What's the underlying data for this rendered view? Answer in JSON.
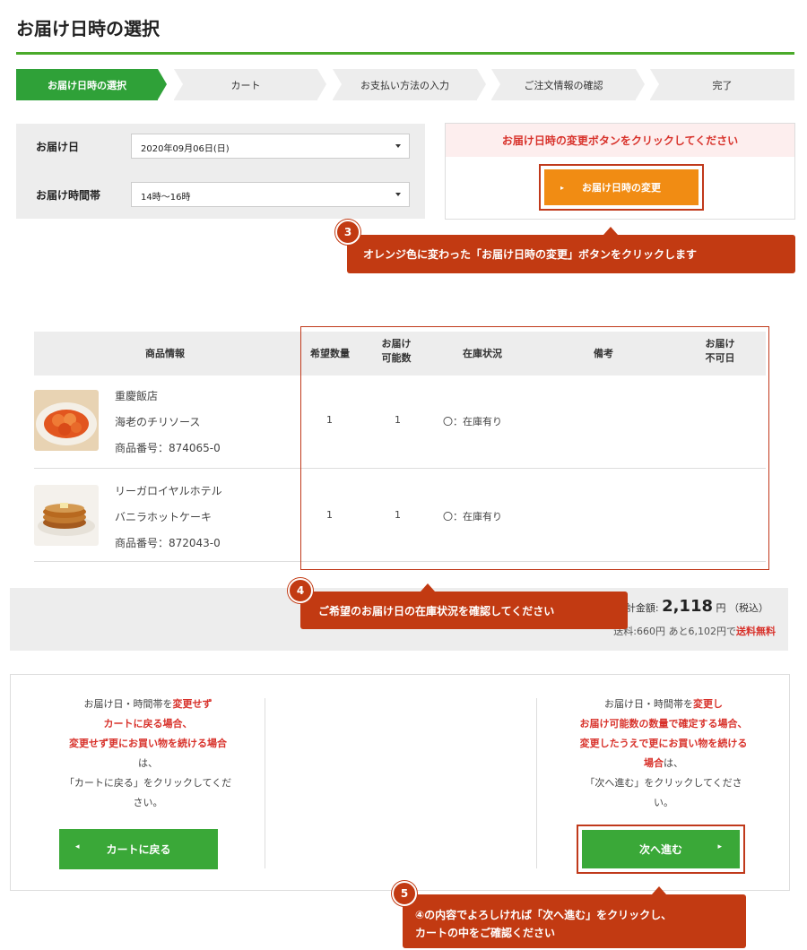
{
  "page_title": "お届け日時の選択",
  "steps": [
    {
      "label": "お届け日時の選択",
      "active": true
    },
    {
      "label": "カート",
      "active": false
    },
    {
      "label": "お支払い方法の入力",
      "active": false
    },
    {
      "label": "ご注文情報の確認",
      "active": false
    },
    {
      "label": "完了",
      "active": false
    }
  ],
  "form": {
    "date_label": "お届け日",
    "date_value": "2020年09月06日(日)",
    "time_label": "お届け時間帯",
    "time_value": "14時～16時"
  },
  "change_panel": {
    "notice": "お届け日時の変更ボタンをクリックしてください",
    "button_label": "お届け日時の変更",
    "button_color": "#f18c13"
  },
  "callouts": {
    "c3": {
      "number": "3",
      "text": "オレンジ色に変わった「お届け日時の変更」ボタンをクリックします"
    },
    "c4": {
      "number": "4",
      "text": "ご希望のお届け日の在庫状況を確認してください"
    },
    "c5": {
      "number": "5",
      "line1": "④の内容でよろしければ「次へ進む」をクリックし、",
      "line2": "カートの中をご確認ください"
    }
  },
  "table": {
    "headers": {
      "product": "商品情報",
      "qty": "希望数量",
      "avail_1": "お届け",
      "avail_2": "可能数",
      "stock": "在庫状況",
      "note": "備考",
      "nodeliv_1": "お届け",
      "nodeliv_2": "不可日"
    },
    "rows": [
      {
        "shop": "重慶飯店",
        "name": "海老のチリソース",
        "code": "商品番号：874065-0",
        "qty": "1",
        "avail": "1",
        "stock": "〇：在庫有り",
        "thumb": "shrimp-chili-photo"
      },
      {
        "shop": "リーガロイヤルホテル",
        "name": "バニラホットケーキ",
        "code": "商品番号：872043-0",
        "qty": "1",
        "avail": "1",
        "stock": "〇：在庫有り",
        "thumb": "hotcake-photo"
      }
    ]
  },
  "totals": {
    "label": "合計金額:",
    "amount": "2,118",
    "unit": "円",
    "tax": "（税込）",
    "shipping": "送料:660円 あと6,102円で",
    "free": "送料無料"
  },
  "bottom": {
    "left": {
      "l1_a": "お届け日・時間帯を",
      "l1_b": "変更せず",
      "l2": "カートに戻る場合、",
      "l3": "変更せず更にお買い物を続ける場合",
      "l4": "は、",
      "l5": "「カートに戻る」をクリックしてくだ",
      "l6": "さい。",
      "button": "カートに戻る"
    },
    "right": {
      "l1_a": "お届け日・時間帯を",
      "l1_b": "変更し",
      "l2": "お届け可能数の数量で確定する場合、",
      "l3": "変更したうえで更にお買い物を続ける",
      "l4_a": "場合",
      "l4_b": "は、",
      "l5": "「次へ進む」をクリックしてくださ",
      "l6": "い。",
      "button": "次へ進む"
    },
    "accent_green": "#3aa838",
    "accent_red": "#d8322b"
  }
}
